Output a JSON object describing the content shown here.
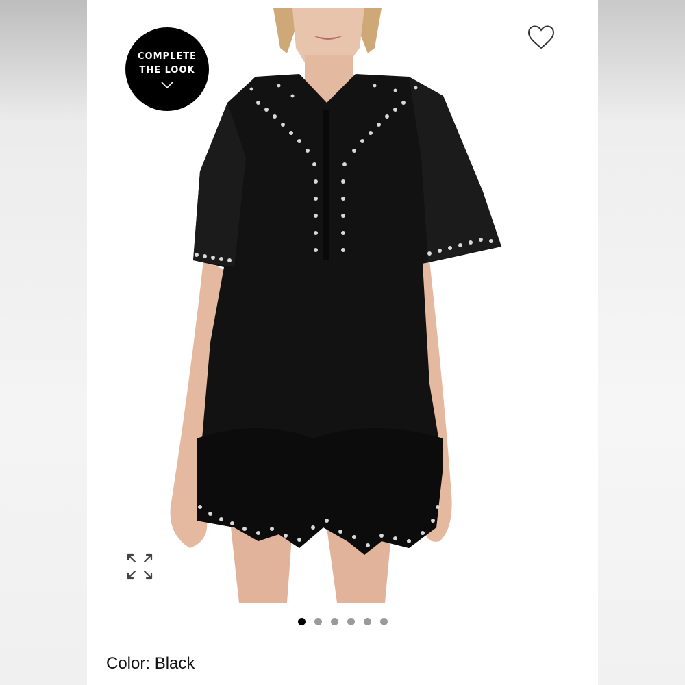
{
  "badge": {
    "line1": "COMPLETE",
    "line2": "THE LOOK",
    "icon": "chevron-down-icon"
  },
  "actions": {
    "favorite_icon": "heart-icon",
    "expand_icon": "expand-icon"
  },
  "carousel": {
    "total": 6,
    "active_index": 0
  },
  "product": {
    "color_label": "Color:",
    "color_value": "Black"
  }
}
